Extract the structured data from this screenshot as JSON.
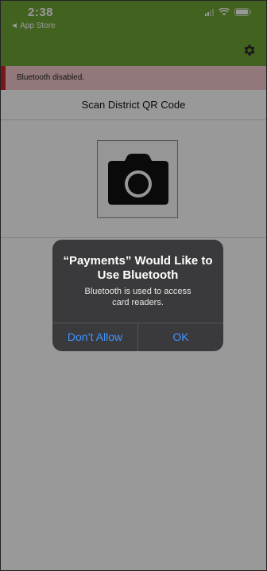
{
  "status_bar": {
    "time": "2:38",
    "back_label": "◄ App Store"
  },
  "alert_bar": {
    "text": "Bluetooth disabled.",
    "color": "#c8262e"
  },
  "header": {
    "color": "#6ea335",
    "settings_icon": "gear-icon"
  },
  "scan": {
    "label": "Scan District QR Code",
    "camera_icon": "camera-icon"
  },
  "dialog": {
    "title_line1": "“Payments” Would Like to",
    "title_line2": "Use Bluetooth",
    "message_line1": "Bluetooth is used to access",
    "message_line2": "card readers.",
    "deny_label": "Don’t Allow",
    "ok_label": "OK",
    "button_color": "#3f94ff"
  }
}
